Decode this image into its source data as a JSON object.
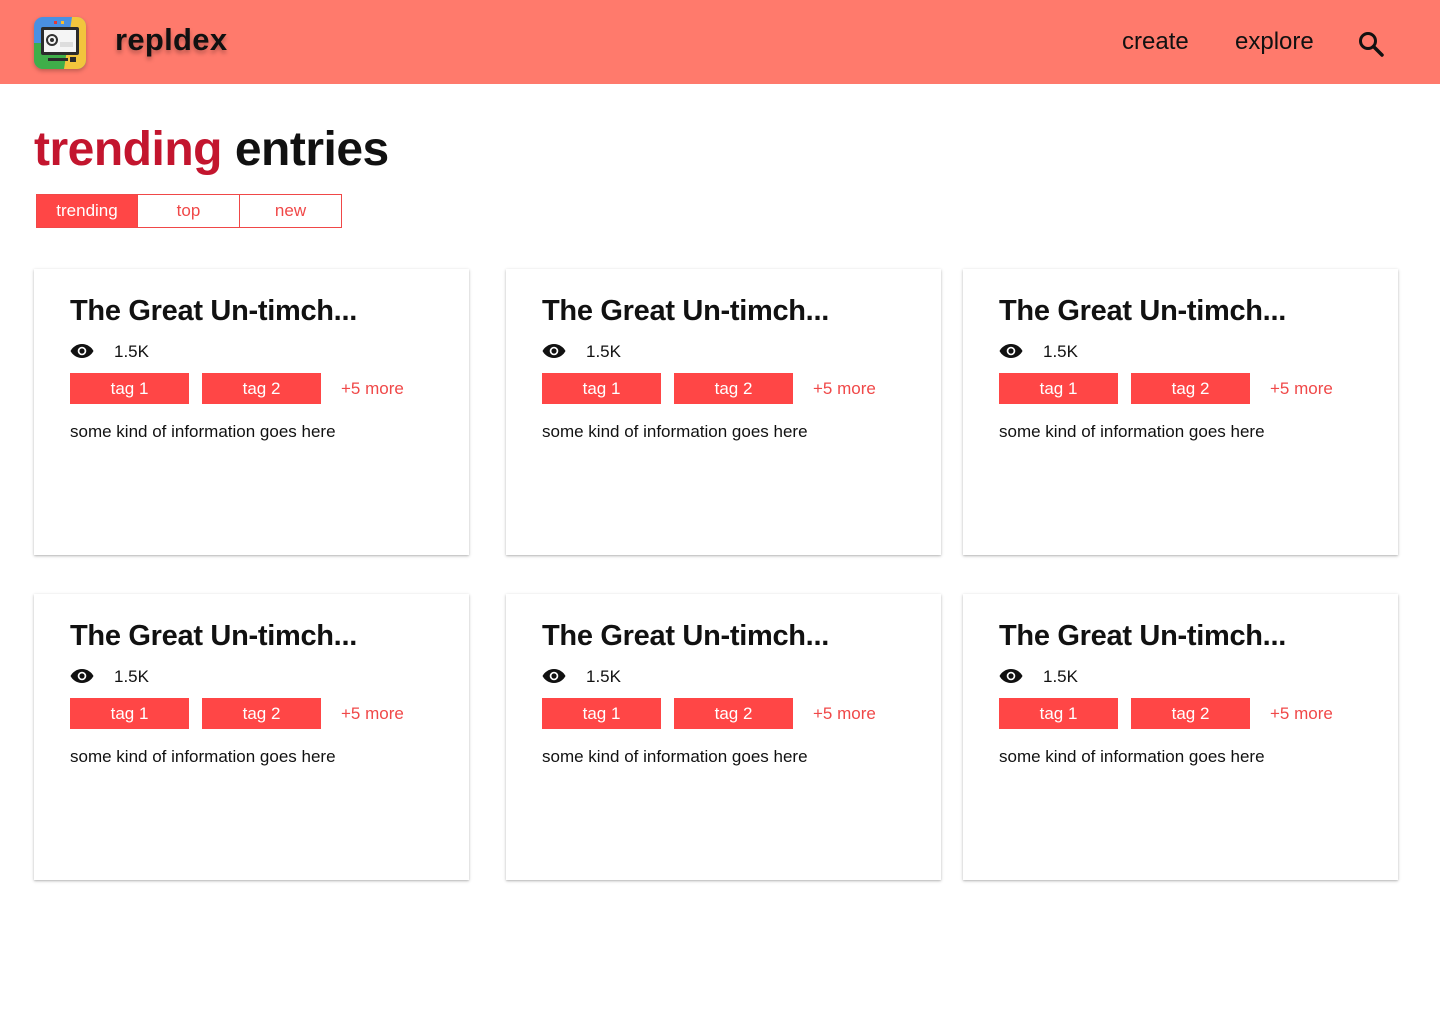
{
  "header": {
    "logo_icon": "repldex-logo-icon",
    "brand": "repldex",
    "nav": {
      "create": "create",
      "explore": "explore"
    },
    "search_icon": "search-icon"
  },
  "page": {
    "title_accent": "trending",
    "title_rest": "entries"
  },
  "tabs": [
    {
      "label": "trending",
      "active": true
    },
    {
      "label": "top",
      "active": false
    },
    {
      "label": "new",
      "active": false
    }
  ],
  "cards": [
    {
      "title": "The Great Un-timch...",
      "views": "1.5K",
      "tags": [
        "tag 1",
        "tag 2"
      ],
      "more": "+5 more",
      "info": "some kind of information goes here"
    },
    {
      "title": "The Great Un-timch...",
      "views": "1.5K",
      "tags": [
        "tag 1",
        "tag 2"
      ],
      "more": "+5 more",
      "info": "some kind of information goes here"
    },
    {
      "title": "The Great Un-timch...",
      "views": "1.5K",
      "tags": [
        "tag 1",
        "tag 2"
      ],
      "more": "+5 more",
      "info": "some kind of information goes here"
    },
    {
      "title": "The Great Un-timch...",
      "views": "1.5K",
      "tags": [
        "tag 1",
        "tag 2"
      ],
      "more": "+5 more",
      "info": "some kind of information goes here"
    },
    {
      "title": "The Great Un-timch...",
      "views": "1.5K",
      "tags": [
        "tag 1",
        "tag 2"
      ],
      "more": "+5 more",
      "info": "some kind of information goes here"
    },
    {
      "title": "The Great Un-timch...",
      "views": "1.5K",
      "tags": [
        "tag 1",
        "tag 2"
      ],
      "more": "+5 more",
      "info": "some kind of information goes here"
    }
  ],
  "colors": {
    "header_bg": "#ff7a6c",
    "accent": "#ff4646",
    "title_accent": "#c3152e"
  }
}
